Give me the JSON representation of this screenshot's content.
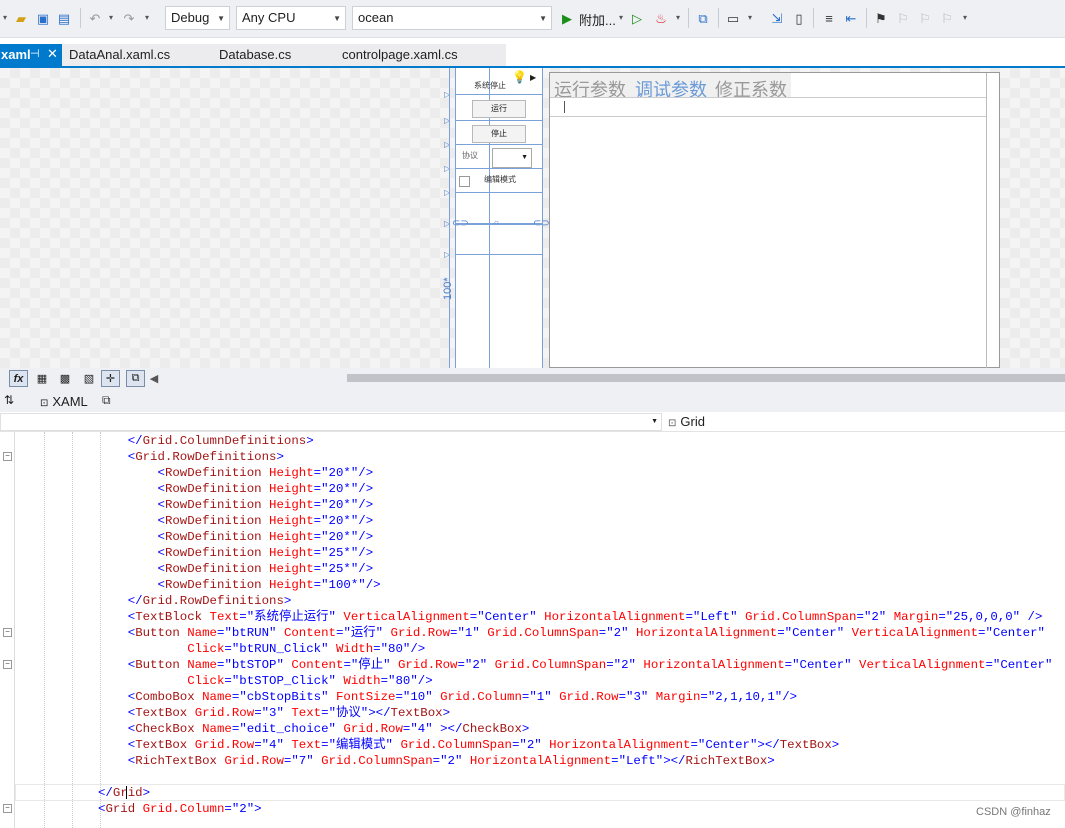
{
  "toolbar": {
    "config": "Debug",
    "platform": "Any CPU",
    "project": "ocean",
    "attach": "附加..."
  },
  "tabs": {
    "active": "xaml",
    "files": [
      "DataAnal.xaml.cs",
      "Database.cs",
      "controlpage.xaml.cs"
    ]
  },
  "designer": {
    "stop_label": "系统停止",
    "run_button": "运行",
    "stop_button": "停止",
    "protocol_label": "协议",
    "edit_mode_label": "编辑模式",
    "row_height_label": "100*",
    "panel_tabs": [
      "运行参数",
      "调试参数",
      "修正系数"
    ],
    "selected_panel_tab": "调试参数"
  },
  "xaml_bar": {
    "tab_label": "XAML"
  },
  "nav": {
    "element": "Grid"
  },
  "code": [
    "    </Grid.ColumnDefinitions>",
    "    <Grid.RowDefinitions>",
    "        <RowDefinition Height=\"20*\"/>",
    "        <RowDefinition Height=\"20*\"/>",
    "        <RowDefinition Height=\"20*\"/>",
    "        <RowDefinition Height=\"20*\"/>",
    "        <RowDefinition Height=\"20*\"/>",
    "        <RowDefinition Height=\"25*\"/>",
    "        <RowDefinition Height=\"25*\"/>",
    "        <RowDefinition Height=\"100*\"/>",
    "    </Grid.RowDefinitions>",
    "    <TextBlock Text=\"系统停止运行\" VerticalAlignment=\"Center\" HorizontalAlignment=\"Left\" Grid.ColumnSpan=\"2\" Margin=\"25,0,0,0\" />",
    "    <Button Name=\"btRUN\" Content=\"运行\" Grid.Row=\"1\" Grid.ColumnSpan=\"2\" HorizontalAlignment=\"Center\" VerticalAlignment=\"Center\"",
    "            Click=\"btRUN_Click\" Width=\"80\"/>",
    "    <Button Name=\"btSTOP\" Content=\"停止\" Grid.Row=\"2\" Grid.ColumnSpan=\"2\" HorizontalAlignment=\"Center\" VerticalAlignment=\"Center\"",
    "            Click=\"btSTOP_Click\" Width=\"80\"/>",
    "    <ComboBox Name=\"cbStopBits\" FontSize=\"10\" Grid.Column=\"1\" Grid.Row=\"3\" Margin=\"2,1,10,1\"/>",
    "    <TextBox Grid.Row=\"3\" Text=\"协议\"></TextBox>",
    "    <CheckBox Name=\"edit_choice\" Grid.Row=\"4\" ></CheckBox>",
    "    <TextBox Grid.Row=\"4\" Text=\"编辑模式\" Grid.ColumnSpan=\"2\" HorizontalAlignment=\"Center\"></TextBox>",
    "    <RichTextBox Grid.Row=\"7\" Grid.ColumnSpan=\"2\" HorizontalAlignment=\"Left\"></RichTextBox>",
    "",
    "</Grid>",
    "<Grid Grid.Column=\"2\">"
  ],
  "watermark": "CSDN @finhaz",
  "colors": {
    "accent": "#007acc",
    "tag": "#a31515",
    "attr": "#ff0000",
    "value": "#0000ff"
  }
}
